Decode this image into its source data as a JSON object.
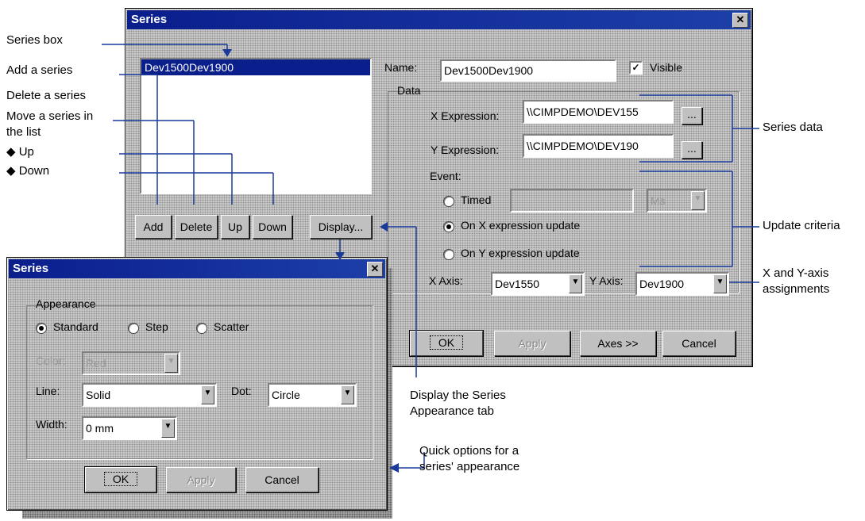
{
  "top_label": "",
  "main_dialog": {
    "title": "Series",
    "close": "✕",
    "series_list": [
      "Dev1500Dev1900"
    ],
    "name_label": "Name:",
    "name_value": "Dev1500Dev1900",
    "visible_label": "Visible",
    "visible_checked": true,
    "data_group": "Data",
    "x_expr_label": "X Expression:",
    "x_expr_value": "\\\\CIMPDEMO\\DEV155",
    "y_expr_label": "Y Expression:",
    "y_expr_value": "\\\\CIMPDEMO\\DEV190",
    "ellipsis": "...",
    "event_label": "Event:",
    "timed_label": "Timed",
    "timed_unit": "Ms",
    "on_x_label": "On X expression update",
    "on_y_label": "On Y expression update",
    "x_axis_label": "X Axis:",
    "x_axis_value": "Dev1550",
    "y_axis_label": "Y Axis:",
    "y_axis_value": "Dev1900",
    "btn_add": "Add",
    "btn_delete": "Delete",
    "btn_up": "Up",
    "btn_down": "Down",
    "btn_display": "Display...",
    "btn_ok": "OK",
    "btn_apply": "Apply",
    "btn_axes": "Axes >>",
    "btn_cancel": "Cancel"
  },
  "sub_dialog": {
    "title": "Series",
    "close": "✕",
    "appearance_group": "Appearance",
    "standard_label": "Standard",
    "step_label": "Step",
    "scatter_label": "Scatter",
    "color_label": "Color:",
    "color_value": "Red",
    "line_label": "Line:",
    "line_value": "Solid",
    "dot_label": "Dot:",
    "dot_value": "Circle",
    "width_label": "Width:",
    "width_value": "0 mm",
    "btn_ok": "OK",
    "btn_apply": "Apply",
    "btn_cancel": "Cancel"
  },
  "annotations": {
    "series_box": "Series box",
    "add_series": "Add a series",
    "delete_series": "Delete a series",
    "move_series_1": "Move a series in",
    "move_series_2": "the list",
    "up": "◆ Up",
    "down": "◆ Down",
    "series_data": "Series data",
    "update_criteria": "Update criteria",
    "axis_assign_1": "X and Y-axis",
    "axis_assign_2": "assignments",
    "display_tab_1": "Display the Series",
    "display_tab_2": "Appearance tab",
    "quick_options_1": "Quick options for a",
    "quick_options_2": "series' appearance"
  },
  "colors": {
    "title_bar": "#0a1e8c",
    "line": "#1a3a9a",
    "dialog_face": "#c8c8c8"
  }
}
